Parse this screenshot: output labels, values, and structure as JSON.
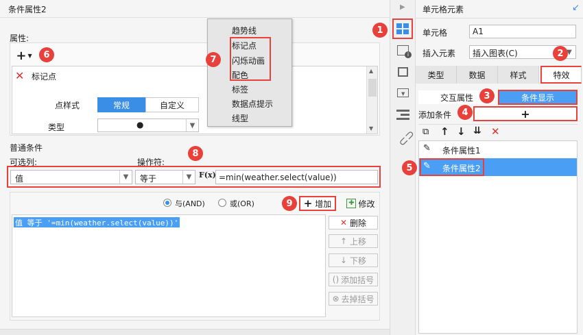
{
  "left_panel": {
    "title": "条件属性2",
    "attributes_label": "属性:",
    "marker_item_label": "标记点",
    "point_style_label": "点样式",
    "point_style_options": [
      "常规",
      "自定义"
    ],
    "type_label": "类型",
    "type_value": "●",
    "common_conditions_label": "普通条件",
    "optional_col_label": "可选列:",
    "operator_label": "操作符:",
    "column_value": "值",
    "operator_value": "等于",
    "formula_icon_text": "F(x)",
    "formula_value": "=min(weather.select(value))",
    "and_label": "与(AND)",
    "or_label": "或(OR)",
    "add_button": "增加",
    "modify_button": "修改",
    "condition_line": "值 等于 '=min(weather.select(value))'",
    "side_buttons": {
      "delete": "删除",
      "move_up": "上移",
      "move_down": "下移",
      "add_bracket": "添加括号",
      "remove_bracket": "去掉括号"
    }
  },
  "dropdown_menu": {
    "items": [
      "趋势线",
      "标记点",
      "闪烁动画",
      "配色",
      "标签",
      "数据点提示",
      "线型"
    ]
  },
  "right_panel": {
    "title": "单元格元素",
    "cell_label": "单元格",
    "cell_value": "A1",
    "insert_label": "插入元素",
    "insert_value": "插入图表(C)",
    "tabs": [
      "类型",
      "数据",
      "样式",
      "特效"
    ],
    "sub_tabs": [
      "交互属性",
      "条件显示"
    ],
    "add_condition_label": "添加条件",
    "add_condition_button": "+",
    "conditions": [
      "条件属性1",
      "条件属性2"
    ]
  },
  "badges": [
    "1",
    "2",
    "3",
    "4",
    "5",
    "6",
    "7",
    "8",
    "9"
  ],
  "colors": {
    "accent_blue": "#3a8ee6",
    "highlight_blue": "#4a9ff5",
    "annotation_red": "#e8403a",
    "delete_red": "#e0322c"
  }
}
